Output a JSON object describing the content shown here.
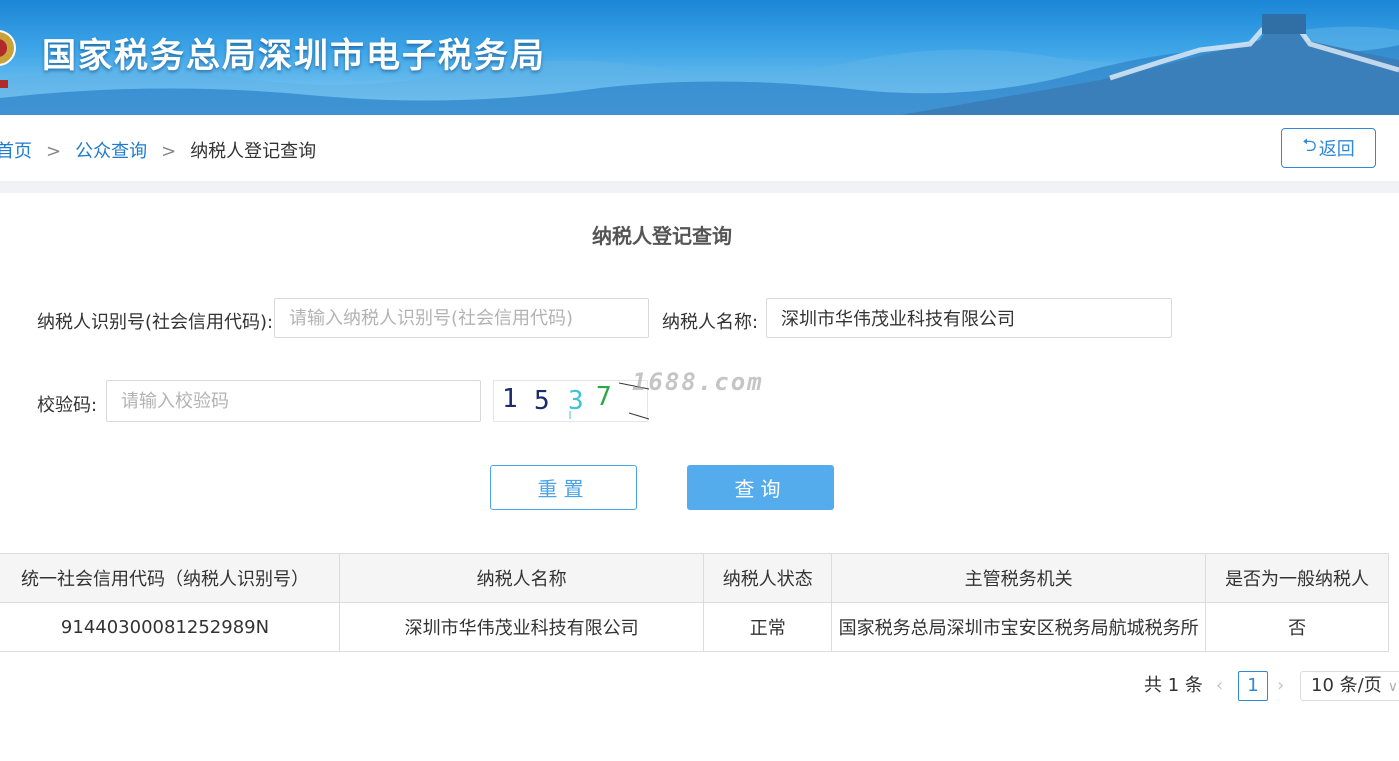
{
  "header": {
    "title": "国家税务总局深圳市电子税务局",
    "colors": {
      "sky_top": "#1b86d6",
      "sky_bottom": "#8fd0f4"
    }
  },
  "breadcrumb": {
    "home": "首页",
    "public_query": "公众查询",
    "current": "纳税人登记查询",
    "separator": ">"
  },
  "back_button": {
    "icon": "return-arrow-icon",
    "label": "返回"
  },
  "form": {
    "title": "纳税人登记查询",
    "taxpayer_id": {
      "label": "纳税人识别号(社会信用代码):",
      "placeholder": "请输入纳税人识别号(社会信用代码)",
      "value": ""
    },
    "taxpayer_name": {
      "label": "纳税人名称:",
      "placeholder": "",
      "value": "深圳市华伟茂业科技有限公司"
    },
    "captcha": {
      "label": "校验码:",
      "placeholder": "请输入校验码",
      "value": "",
      "image_digits": [
        "1",
        "5",
        "3",
        "7"
      ]
    },
    "watermark": "1688.com",
    "reset_label": "重置",
    "query_label": "查询"
  },
  "table": {
    "headers": [
      "统一社会信用代码（纳税人识别号）",
      "纳税人名称",
      "纳税人状态",
      "主管税务机关",
      "是否为一般纳税人"
    ],
    "rows": [
      [
        "91440300081252989N",
        "深圳市华伟茂业科技有限公司",
        "正常",
        "国家税务总局深圳市宝安区税务局航城税务所",
        "否"
      ]
    ]
  },
  "pagination": {
    "total_label": "共 1 条",
    "current_page": "1",
    "page_size": "10 条/页",
    "prev_icon": "chevron-left-icon",
    "next_icon": "chevron-right-icon"
  },
  "colors": {
    "accent": "#2f88d8",
    "query_button": "#55acec",
    "link": "#1f7bd0"
  }
}
